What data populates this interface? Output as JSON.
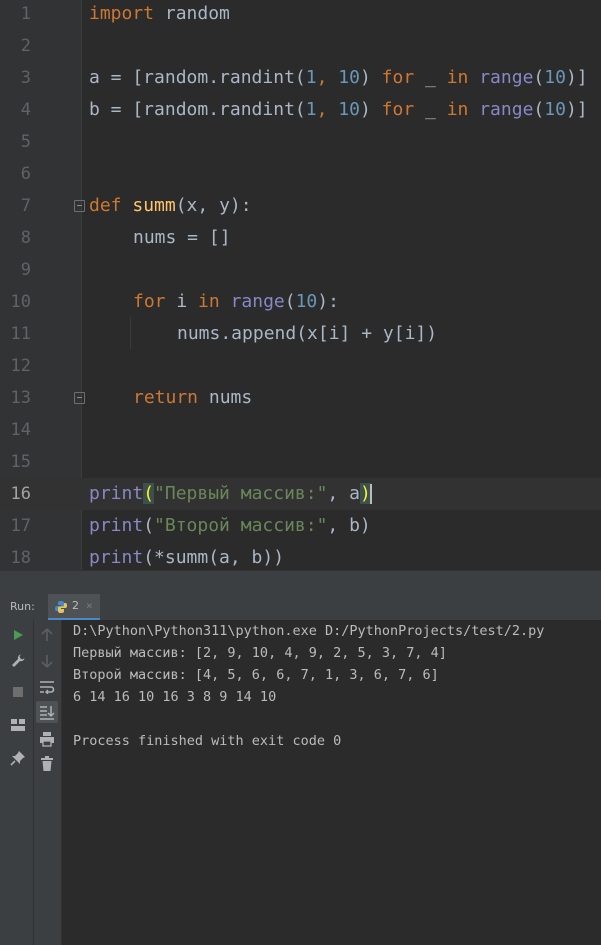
{
  "editor": {
    "line_numbers": [
      "1",
      "2",
      "3",
      "4",
      "5",
      "6",
      "7",
      "8",
      "9",
      "10",
      "11",
      "12",
      "13",
      "14",
      "15",
      "16",
      "17",
      "18"
    ],
    "current_line": "16",
    "code": {
      "l1": {
        "kw": "import",
        "rest": " random"
      },
      "l3": {
        "pre": "a = [random.randint(",
        "n1": "1",
        "comma": ", ",
        "n2": "10",
        "close": ") ",
        "for": "for",
        "mid": " _ ",
        "in": "in",
        "sp": " ",
        "range": "range",
        "open": "(",
        "n3": "10",
        "end": ")]"
      },
      "l4": {
        "pre": "b = [random.randint(",
        "n1": "1",
        "comma": ", ",
        "n2": "10",
        "close": ") ",
        "for": "for",
        "mid": " _ ",
        "in": "in",
        "sp": " ",
        "range": "range",
        "open": "(",
        "n3": "10",
        "end": ")]"
      },
      "l7": {
        "def": "def",
        "sp": " ",
        "name": "summ",
        "params": "(x, y):"
      },
      "l8": {
        "text": "nums = []"
      },
      "l10": {
        "for": "for",
        "mid": " i ",
        "in": "in",
        "sp": " ",
        "range": "range",
        "open": "(",
        "num": "10",
        "end": "):"
      },
      "l11": {
        "text": "nums.append(x[i] + y[i])"
      },
      "l13": {
        "kw": "return",
        "rest": " nums"
      },
      "l16": {
        "print": "print",
        "open": "(",
        "str": "\"Первый массив:\"",
        "mid": ", a",
        "close": ")"
      },
      "l17": {
        "print": "print",
        "open": "(",
        "str": "\"Второй массив:\"",
        "rest": ", b)"
      },
      "l18": {
        "print": "print",
        "rest": "(*summ(a, b))"
      }
    }
  },
  "run_panel": {
    "label": "Run:",
    "tab_name": "2",
    "tab_close": "×",
    "output": [
      "D:\\Python\\Python311\\python.exe D:/PythonProjects/test/2.py",
      "Первый массив: [2, 9, 10, 4, 9, 2, 5, 3, 7, 4]",
      "Второй массив: [4, 5, 6, 6, 7, 1, 3, 6, 7, 6]",
      "6 14 16 10 16 3 8 9 14 10",
      "",
      "Process finished with exit code 0"
    ]
  },
  "icons": {
    "toolbar_left": [
      "run-icon",
      "wrench-icon",
      "stop-icon",
      "layout-icon",
      "pin-icon"
    ],
    "toolbar_right": [
      "up-arrow-icon",
      "down-arrow-icon",
      "soft-wrap-icon",
      "scroll-to-end-icon",
      "print-icon",
      "trash-icon"
    ]
  },
  "colors": {
    "keyword": "#cc7832",
    "number": "#6897bb",
    "builtin": "#8888c6",
    "function": "#ffc66d",
    "string": "#6a8759",
    "run_green": "#499c54"
  }
}
